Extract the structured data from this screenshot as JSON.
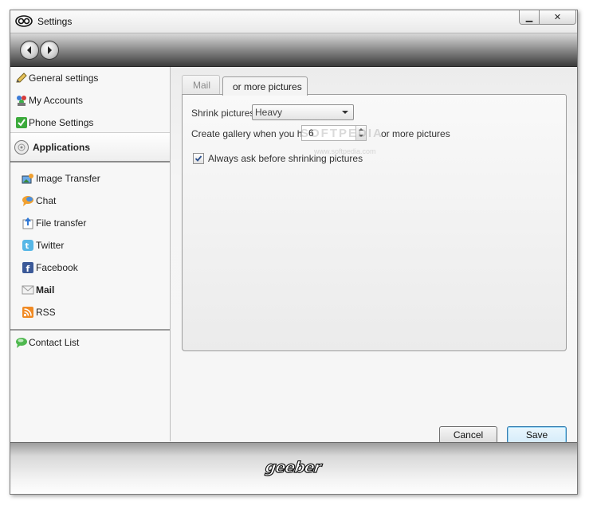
{
  "window": {
    "title": "Settings",
    "controls": {
      "minimize": "▁",
      "close": "✕"
    }
  },
  "sidebar": {
    "items": [
      {
        "label": "General settings",
        "icon": "pencil-icon"
      },
      {
        "label": "My Accounts",
        "icon": "accounts-icon"
      },
      {
        "label": "Phone Settings",
        "icon": "check-icon"
      }
    ],
    "section_header": {
      "label": "Applications",
      "icon": "applications-icon"
    },
    "app_items": [
      {
        "label": "Image Transfer",
        "icon": "image-transfer-icon"
      },
      {
        "label": "Chat",
        "icon": "chat-icon"
      },
      {
        "label": "File transfer",
        "icon": "file-transfer-icon"
      },
      {
        "label": "Twitter",
        "icon": "twitter-icon"
      },
      {
        "label": "Facebook",
        "icon": "facebook-icon"
      },
      {
        "label": "Mail",
        "icon": "mail-icon",
        "selected": true
      },
      {
        "label": "RSS",
        "icon": "rss-icon"
      }
    ],
    "bottom_item": {
      "label": "Contact List",
      "icon": "contact-list-icon"
    }
  },
  "tabs": [
    {
      "label": "Mail",
      "active": false
    },
    {
      "label": "or more pictures",
      "active": true
    }
  ],
  "form": {
    "shrink_label": "Shrink pictures",
    "shrink_value": "Heavy",
    "gallery_label": "Create gallery when you have",
    "gallery_value": "6",
    "gallery_suffix": "or more pictures",
    "ask_label": "Always ask before shrinking pictures",
    "ask_checked": true
  },
  "watermark": {
    "main": "SOFTPEDIA",
    "sub": "www.softpedia.com"
  },
  "buttons": {
    "cancel": "Cancel",
    "save": "Save"
  },
  "footer": {
    "logo_text": "geeber"
  },
  "colors": {
    "accent_border": "#3c7fb1",
    "nav_dark": "#3b3b3b",
    "sidebar_bg": "#f7f7f7"
  }
}
